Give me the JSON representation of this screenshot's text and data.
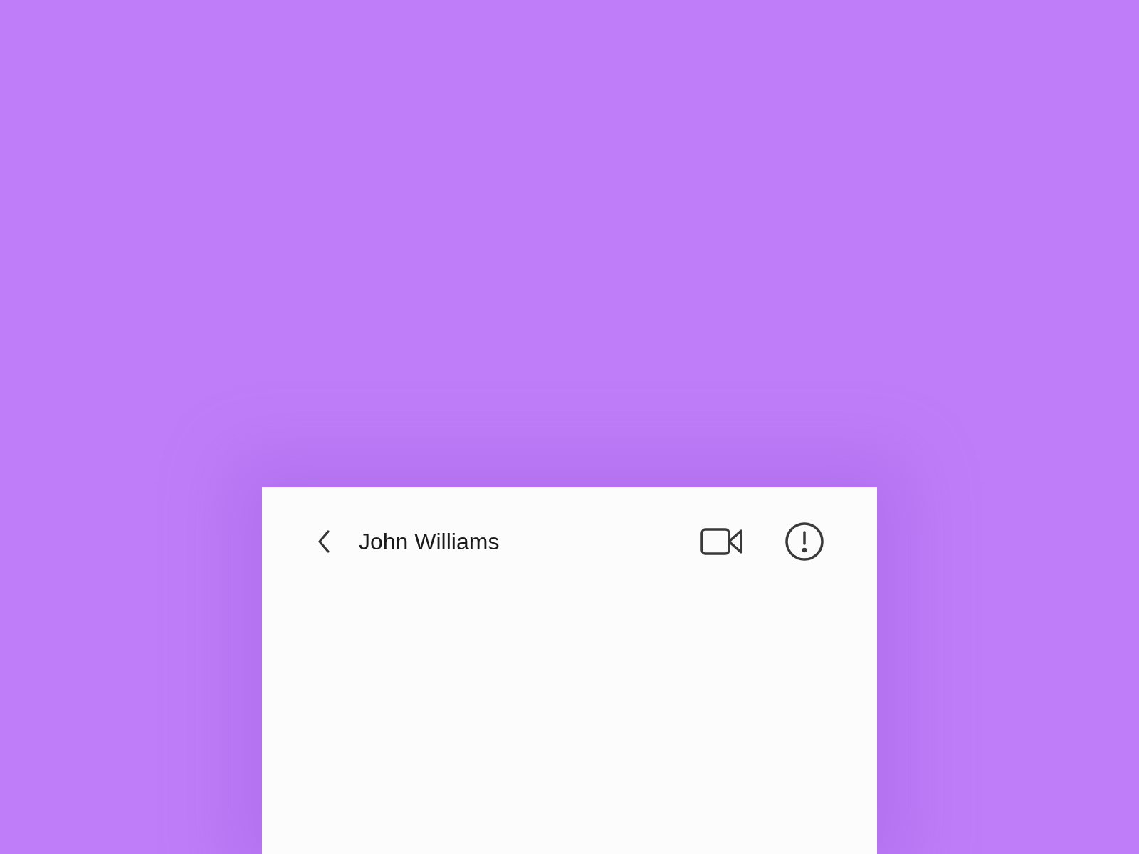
{
  "header": {
    "title": "John Williams"
  }
}
